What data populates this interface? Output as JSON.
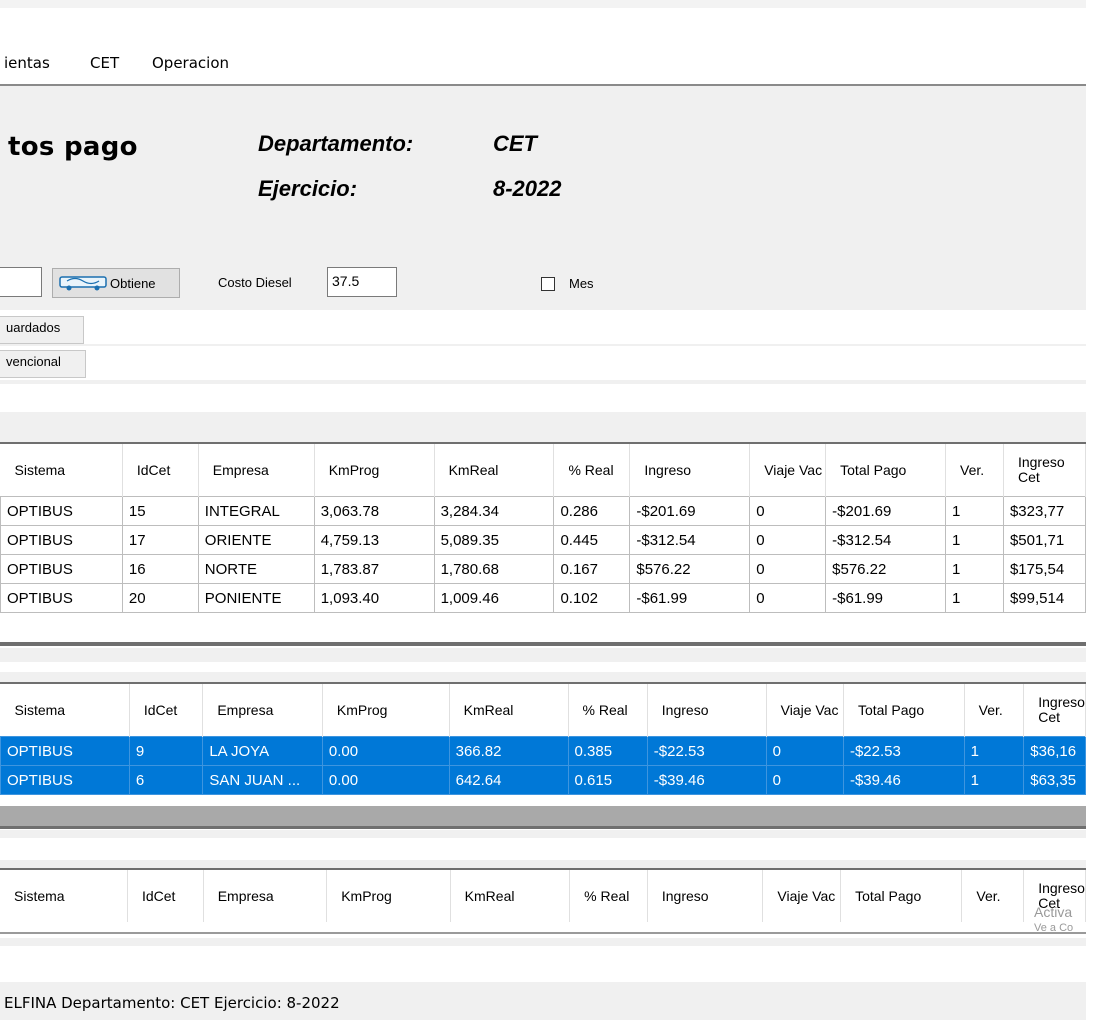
{
  "menu": {
    "items": [
      "ientas",
      "CET",
      "Operacion"
    ]
  },
  "header": {
    "title": "tos pago",
    "department_label": "Departamento:",
    "department_value": "CET",
    "period_label": "Ejercicio:",
    "period_value": "8-2022"
  },
  "controls": {
    "obtain_label": "Obtiene",
    "diesel_label": "Costo Diesel",
    "diesel_value": "37.5",
    "month_label": "Mes",
    "month_checked": false
  },
  "tabs": {
    "saved": "uardados",
    "conventional": "vencional"
  },
  "columns": [
    "Sistema",
    "IdCet",
    "Empresa",
    "KmProg",
    "KmReal",
    "% Real",
    "Ingreso",
    "Viaje Vac",
    "Total Pago",
    "Ver.",
    "Ingreso Cet"
  ],
  "grid1": {
    "rows": [
      [
        "OPTIBUS",
        "15",
        "INTEGRAL",
        "3,063.78",
        "3,284.34",
        "0.286",
        "-$201.69",
        "0",
        "-$201.69",
        "1",
        "$323,77"
      ],
      [
        "OPTIBUS",
        "17",
        "ORIENTE",
        "4,759.13",
        "5,089.35",
        "0.445",
        "-$312.54",
        "0",
        "-$312.54",
        "1",
        "$501,71"
      ],
      [
        "OPTIBUS",
        "16",
        "NORTE",
        "1,783.87",
        "1,780.68",
        "0.167",
        "$576.22",
        "0",
        "$576.22",
        "1",
        "$175,54"
      ],
      [
        "OPTIBUS",
        "20",
        "PONIENTE",
        "1,093.40",
        "1,009.46",
        "0.102",
        "-$61.99",
        "0",
        "-$61.99",
        "1",
        "$99,514"
      ]
    ]
  },
  "grid2": {
    "rows": [
      [
        "OPTIBUS",
        "9",
        "LA JOYA",
        "0.00",
        "366.82",
        "0.385",
        "-$22.53",
        "0",
        "-$22.53",
        "1",
        "$36,16"
      ],
      [
        "OPTIBUS",
        "6",
        "SAN JUAN ...",
        "0.00",
        "642.64",
        "0.615",
        "-$39.46",
        "0",
        "-$39.46",
        "1",
        "$63,35"
      ]
    ]
  },
  "status": {
    "text": "ELFINA  Departamento: CET  Ejercicio: 8-2022"
  },
  "watermark": {
    "line1": "Activa",
    "line2": "Ve a Co"
  },
  "colors": {
    "selection": "#0078d7",
    "background": "#f0f0f0"
  }
}
